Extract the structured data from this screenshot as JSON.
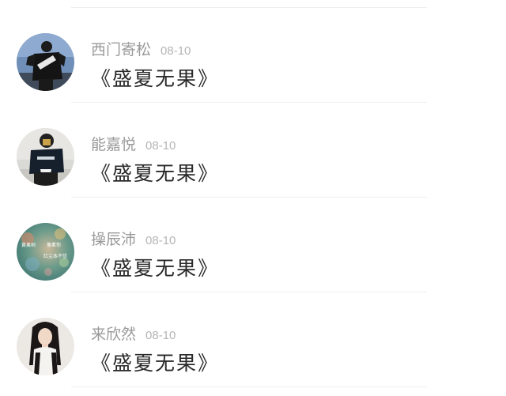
{
  "feed": {
    "items": [
      {
        "name": "西门寄松",
        "date": "08-10",
        "title": "《盛夏无果》"
      },
      {
        "name": "能嘉悦",
        "date": "08-10",
        "title": "《盛夏无果》"
      },
      {
        "name": "操辰沛",
        "date": "08-10",
        "title": "《盛夏无果》",
        "avatar_text": [
          "黄果树",
          "像素你",
          "红尘本不信"
        ]
      },
      {
        "name": "来欣然",
        "date": "08-10",
        "title": "《盛夏无果》"
      }
    ]
  },
  "colors": {
    "name": "#9a9a9a",
    "date": "#b5b5b5",
    "title": "#2a2a2a",
    "divider": "#efefef"
  }
}
